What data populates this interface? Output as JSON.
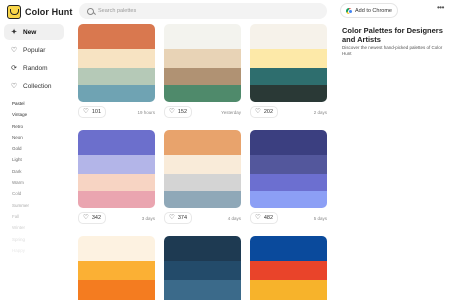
{
  "app": {
    "name": "Color Hunt"
  },
  "search": {
    "placeholder": "Search palettes"
  },
  "header": {
    "chrome_button": "Add to Chrome",
    "more_icon": "more-icon"
  },
  "nav": [
    {
      "label": "New",
      "icon": "sparkle-icon",
      "active": true
    },
    {
      "label": "Popular",
      "icon": "heart-icon"
    },
    {
      "label": "Random",
      "icon": "random-icon"
    },
    {
      "label": "Collection",
      "icon": "heart-icon"
    }
  ],
  "tags": [
    {
      "label": "Pastel",
      "color": "#222222"
    },
    {
      "label": "Vintage",
      "color": "#333333"
    },
    {
      "label": "Retro",
      "color": "#444444"
    },
    {
      "label": "Neon",
      "color": "#555555"
    },
    {
      "label": "Gold",
      "color": "#5a5a5a"
    },
    {
      "label": "Light",
      "color": "#666666"
    },
    {
      "label": "Dark",
      "color": "#707070"
    },
    {
      "label": "Warm",
      "color": "#808080"
    },
    {
      "label": "Cold",
      "color": "#909090"
    },
    {
      "label": "Summer",
      "color": "#a8a8a8"
    },
    {
      "label": "Fall",
      "color": "#bdbdbd"
    },
    {
      "label": "Winter",
      "color": "#cfcfcf"
    },
    {
      "label": "Spring",
      "color": "#dddddd"
    },
    {
      "label": "Happy",
      "color": "#e8e8e8"
    }
  ],
  "info": {
    "title": "Color Palettes for Designers and Artists",
    "description": "Discover the newest hand-picked palettes of Color Hunt"
  },
  "palettes": [
    {
      "colors": [
        "#d9784f",
        "#f7e3c2",
        "#b5c9b7",
        "#6fa3b3"
      ],
      "likes": "101",
      "time": "19 hours"
    },
    {
      "colors": [
        "#f3f3ee",
        "#e8d3b6",
        "#b09273",
        "#4f8a6b"
      ],
      "likes": "152",
      "time": "Yesterday"
    },
    {
      "colors": [
        "#f6f2ea",
        "#fde9a8",
        "#2e6e6e",
        "#2a3936"
      ],
      "likes": "202",
      "time": "2 days"
    },
    {
      "colors": [
        "#6c6fcc",
        "#b3b5e8",
        "#f7d4c3",
        "#eaa5b0"
      ],
      "likes": "342",
      "time": "3 days"
    },
    {
      "colors": [
        "#e8a36c",
        "#f9ebd9",
        "#d4d4d4",
        "#8fa8b8"
      ],
      "likes": "374",
      "time": "4 days"
    },
    {
      "colors": [
        "#3b3f80",
        "#53579c",
        "#6c6fd0",
        "#8c9ff5"
      ],
      "likes": "482",
      "time": "5 days"
    },
    {
      "colors": [
        "#fdf2e1",
        "#fbb034",
        "#f47c20",
        "#f47c20"
      ],
      "likes": "",
      "time": ""
    },
    {
      "colors": [
        "#1e3a52",
        "#234b6a",
        "#3b6a8a",
        "#3b6a8a"
      ],
      "likes": "",
      "time": ""
    },
    {
      "colors": [
        "#0a4a9c",
        "#e9442a",
        "#f7b32b",
        "#f7b32b"
      ],
      "likes": "",
      "time": ""
    }
  ]
}
